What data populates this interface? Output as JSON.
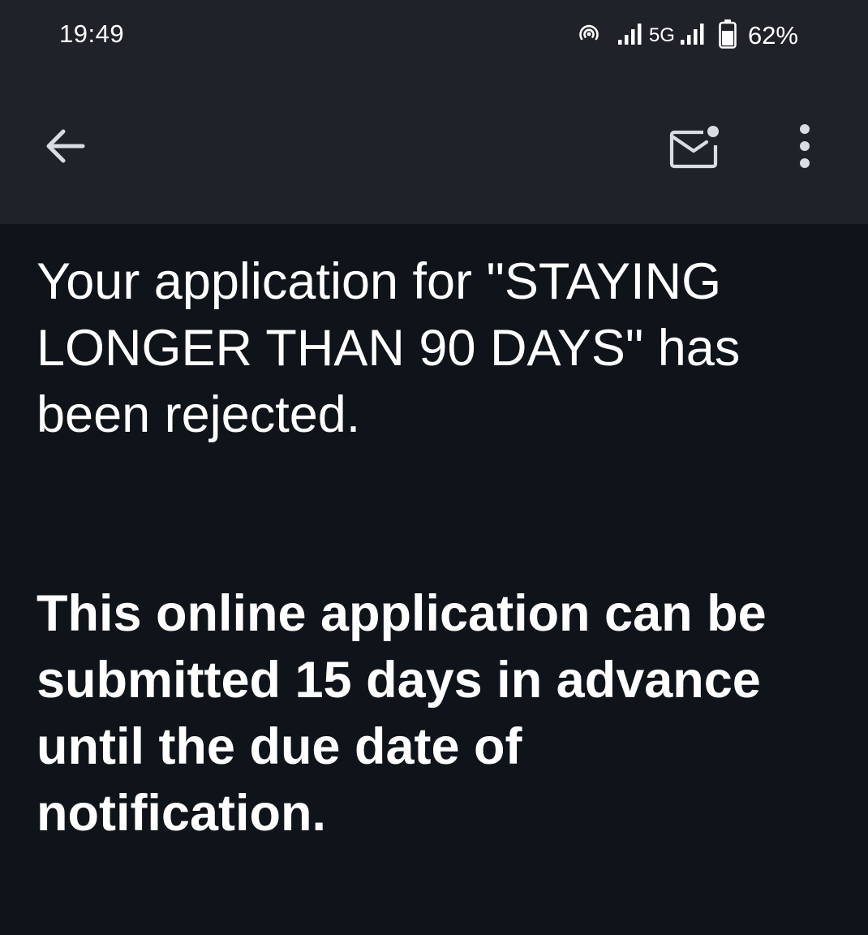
{
  "status_bar": {
    "time": "19:49",
    "network": "5G",
    "battery": "62%",
    "icons": [
      "hotspot-icon",
      "signal-icon",
      "signal-icon",
      "battery-icon"
    ]
  },
  "toolbar": {
    "back_icon": "arrow-left-icon",
    "mail_icon": "mark-unread-mail-icon",
    "more_icon": "more-vertical-icon"
  },
  "message": {
    "paragraph_1": "Your application for \"STAYING LONGER THAN 90 DAYS\" has been rejected.",
    "paragraph_2": "This online application can be submitted 15 days in advance until the due date of notification."
  },
  "colors": {
    "topbar_bg": "#1f2329",
    "body_bg": "#0f141a",
    "text": "#ffffff",
    "icon": "#d9dde2"
  }
}
